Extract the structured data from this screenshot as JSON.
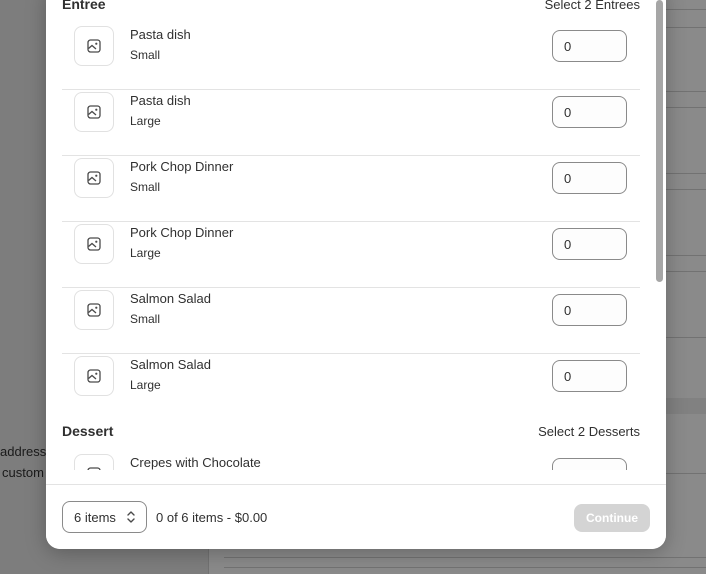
{
  "background": {
    "partial_text_1": "address",
    "partial_text_2": "custom"
  },
  "modal": {
    "sections": [
      {
        "title": "Entree",
        "hint": "Select 2 Entrees",
        "items": [
          {
            "name": "Pasta dish",
            "variant": "Small",
            "qty": "0"
          },
          {
            "name": "Pasta dish",
            "variant": "Large",
            "qty": "0"
          },
          {
            "name": "Pork Chop Dinner",
            "variant": "Small",
            "qty": "0"
          },
          {
            "name": "Pork Chop Dinner",
            "variant": "Large",
            "qty": "0"
          },
          {
            "name": "Salmon Salad",
            "variant": "Small",
            "qty": "0"
          },
          {
            "name": "Salmon Salad",
            "variant": "Large",
            "qty": "0"
          }
        ]
      },
      {
        "title": "Dessert",
        "hint": "Select 2 Desserts",
        "items": [
          {
            "name": "Crepes with Chocolate",
            "variant": "",
            "qty": ""
          }
        ]
      }
    ],
    "footer": {
      "items_select": "6 items",
      "summary": "0 of 6 items - $0.00",
      "continue_label": "Continue"
    }
  },
  "icons": {
    "thumb": "image-placeholder-icon",
    "select": "chevron-up-down-icon"
  },
  "colors": {
    "overlay": "#7d7d7d",
    "modal_bg": "#ffffff",
    "text": "#303030",
    "button_disabled": "#d4d4d4"
  }
}
